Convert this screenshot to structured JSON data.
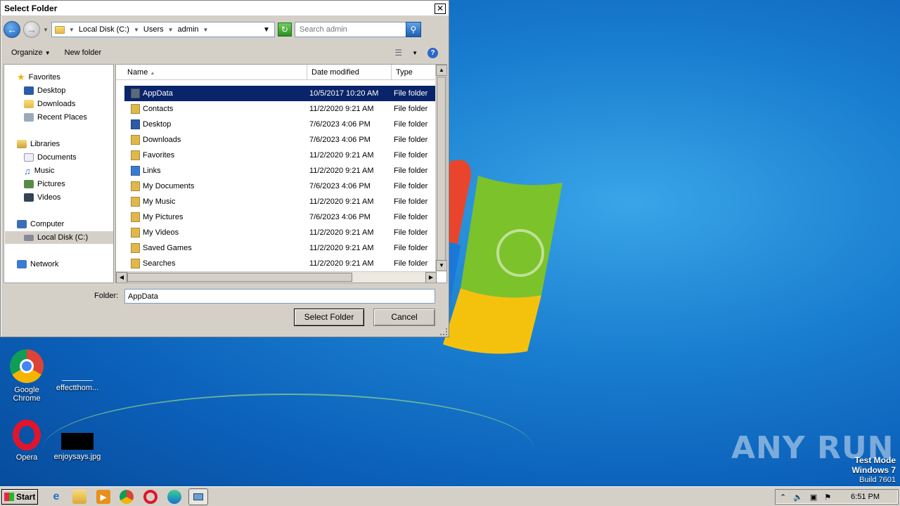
{
  "dialog": {
    "title": "Select Folder",
    "close_label": "✕",
    "breadcrumb": [
      "Local Disk (C:)",
      "Users",
      "admin"
    ],
    "search_placeholder": "Search admin",
    "toolbar": {
      "organize": "Organize",
      "new_folder": "New folder"
    },
    "nav": {
      "favorites": "Favorites",
      "favorites_items": [
        "Desktop",
        "Downloads",
        "Recent Places"
      ],
      "libraries": "Libraries",
      "libraries_items": [
        "Documents",
        "Music",
        "Pictures",
        "Videos"
      ],
      "computer": "Computer",
      "computer_items": [
        "Local Disk (C:)"
      ],
      "network": "Network"
    },
    "columns": {
      "name": "Name",
      "date": "Date modified",
      "type": "Type"
    },
    "files": [
      {
        "name": "AppData",
        "date": "10/5/2017 10:20 AM",
        "type": "File folder"
      },
      {
        "name": "Contacts",
        "date": "11/2/2020 9:21 AM",
        "type": "File folder"
      },
      {
        "name": "Desktop",
        "date": "7/6/2023 4:06 PM",
        "type": "File folder"
      },
      {
        "name": "Downloads",
        "date": "7/6/2023 4:06 PM",
        "type": "File folder"
      },
      {
        "name": "Favorites",
        "date": "11/2/2020 9:21 AM",
        "type": "File folder"
      },
      {
        "name": "Links",
        "date": "11/2/2020 9:21 AM",
        "type": "File folder"
      },
      {
        "name": "My Documents",
        "date": "7/6/2023 4:06 PM",
        "type": "File folder"
      },
      {
        "name": "My Music",
        "date": "11/2/2020 9:21 AM",
        "type": "File folder"
      },
      {
        "name": "My Pictures",
        "date": "7/6/2023 4:06 PM",
        "type": "File folder"
      },
      {
        "name": "My Videos",
        "date": "11/2/2020 9:21 AM",
        "type": "File folder"
      },
      {
        "name": "Saved Games",
        "date": "11/2/2020 9:21 AM",
        "type": "File folder"
      },
      {
        "name": "Searches",
        "date": "11/2/2020 9:21 AM",
        "type": "File folder"
      }
    ],
    "folder_label": "Folder:",
    "folder_value": "AppData",
    "select_button": "Select Folder",
    "cancel_button": "Cancel"
  },
  "desktop": {
    "icons": [
      "Google Chrome",
      "effectthom...",
      "Opera",
      "enjoysays.jpg"
    ],
    "watermark": "ANY RUN",
    "test_mode": [
      "Test Mode",
      "Windows 7",
      "Build 7601"
    ]
  },
  "taskbar": {
    "start": "Start",
    "clock": "6:51 PM"
  }
}
